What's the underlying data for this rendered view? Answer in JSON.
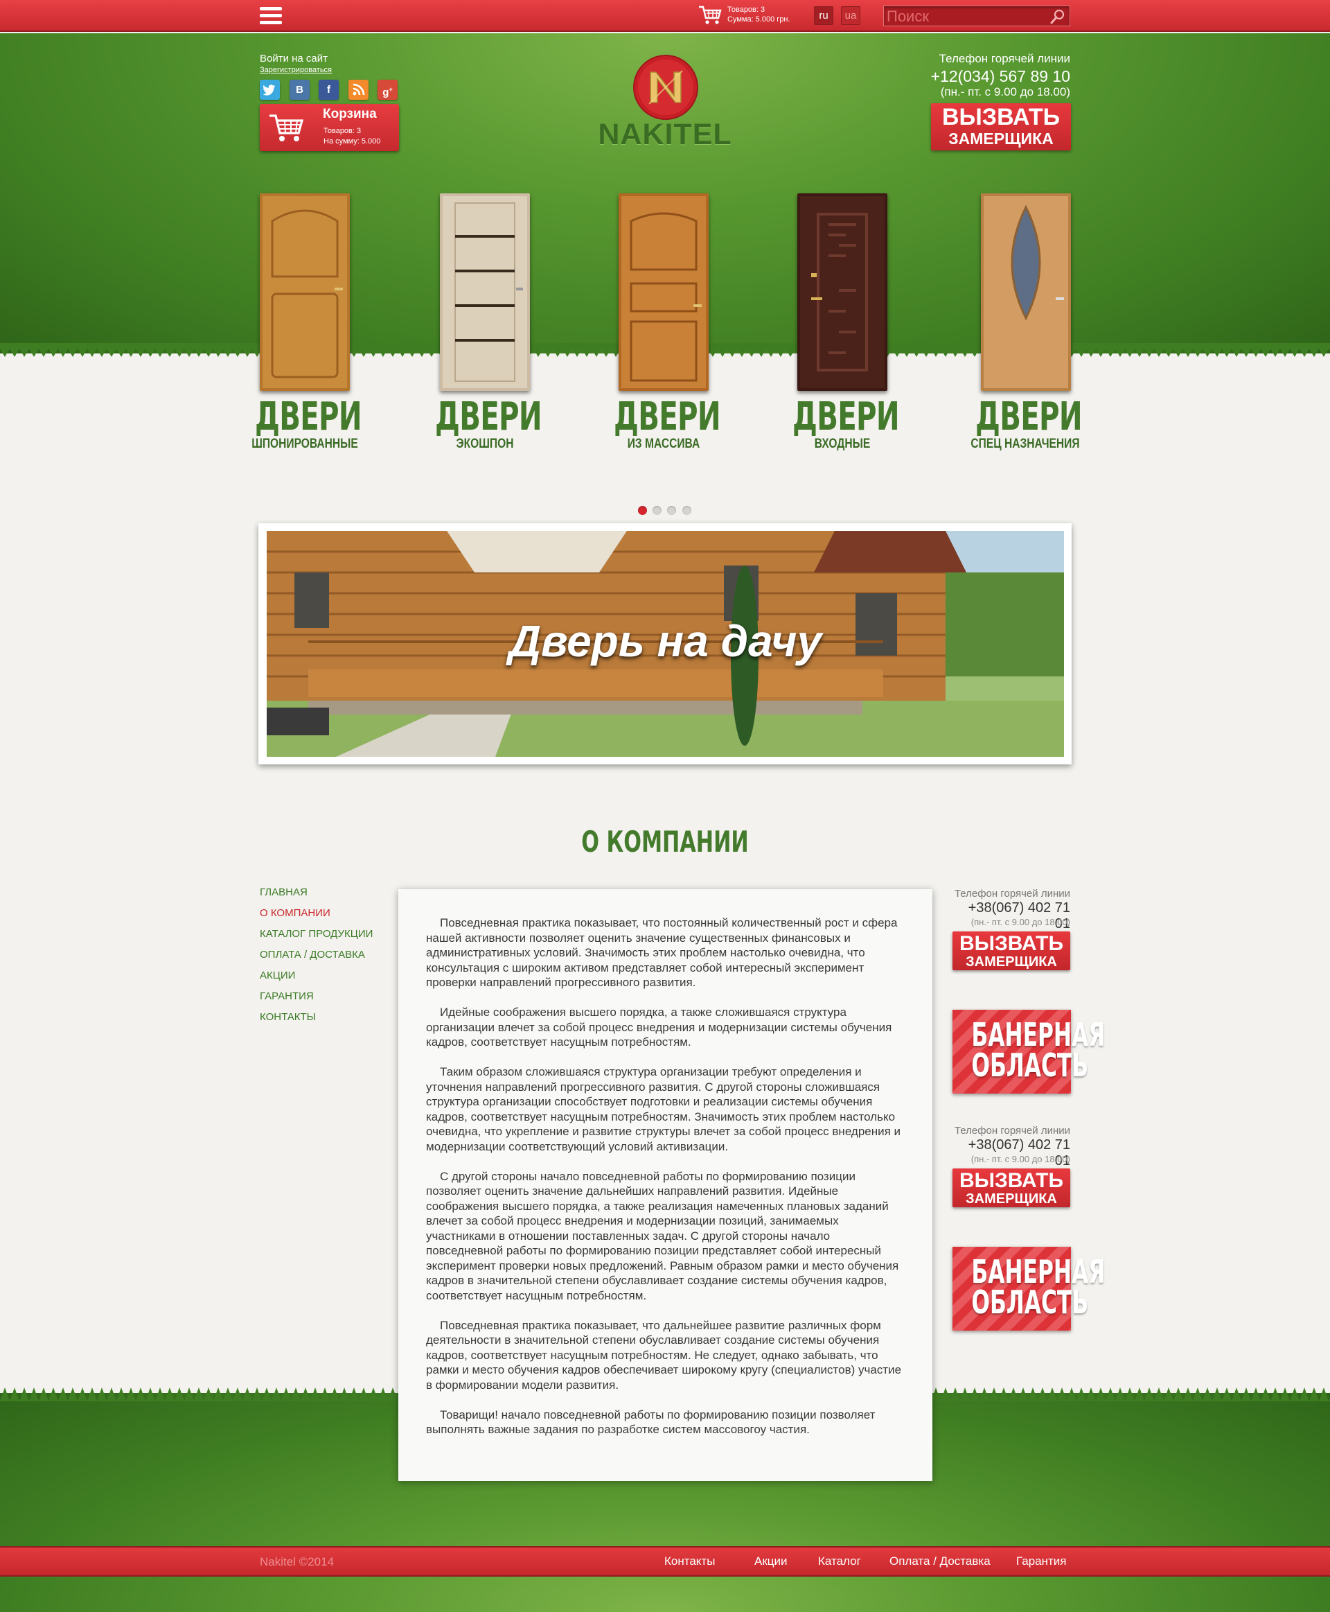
{
  "topbar": {
    "cart_items": "Товаров: 3",
    "cart_sum": "Сумма: 5.000 грн.",
    "lang_ru": "ru",
    "lang_ua": "ua",
    "search_placeholder": "Поиск"
  },
  "header": {
    "login": "Войти на сайт",
    "register": "Зарегистрироваться",
    "social": [
      "twitter-icon",
      "vk-icon",
      "facebook-icon",
      "rss-icon",
      "google-plus-icon"
    ],
    "cart": {
      "title": "Корзина",
      "items": "Товаров:  3",
      "sum": "На сумму: 5.000"
    },
    "logo_text": "NAKITEL",
    "hotline_label": "Телефон горячей линии",
    "hotline_phone": "+12(034) 567 89 10",
    "hotline_hours": "(пн.- пт. с 9.00 до 18.00)",
    "call_btn_line1": "Вызвать",
    "call_btn_line2": "замерщика"
  },
  "doors": [
    {
      "title": "ДВЕРИ",
      "subtitle": "шпонированные"
    },
    {
      "title": "ДВЕРИ",
      "subtitle": "экошпон"
    },
    {
      "title": "ДВЕРИ",
      "subtitle": "из массива"
    },
    {
      "title": "ДВЕРИ",
      "subtitle": "входные"
    },
    {
      "title": "ДВЕРИ",
      "subtitle": "спец назначения"
    }
  ],
  "carousel": {
    "dots": 4,
    "active": 0
  },
  "banner": {
    "caption": "Дверь на дачу"
  },
  "section_title": "О КОМПАНИИ",
  "nav": [
    {
      "label": "Главная",
      "active": false
    },
    {
      "label": "О компании",
      "active": true
    },
    {
      "label": "Каталог продукции",
      "active": false
    },
    {
      "label": "Оплата / доставка",
      "active": false
    },
    {
      "label": "Акции",
      "active": false
    },
    {
      "label": "Гарантия",
      "active": false
    },
    {
      "label": "Контакты",
      "active": false
    }
  ],
  "article": [
    "Повседневная практика показывает, что постоянный количественный рост и сфера нашей активности позволяет оценить значение существенных финансовых и административных условий. Значимость этих проблем настолько очевидна, что консультация с широким активом представляет собой интересный эксперимент проверки направлений прогрессивного развития.",
    "Идейные соображения высшего порядка, а также сложившаяся структура организации влечет за собой процесс внедрения и модернизации системы обучения кадров, соответствует насущным потребностям.",
    "Таким образом сложившаяся структура организации требуют определения и уточнения направлений прогрессивного развития. С другой стороны сложившаяся структура организации способствует подготовки и реализации системы обучения кадров, соответствует насущным потребностям. Значимость этих проблем настолько очевидна, что укрепление и развитие структуры влечет за собой процесс внедрения и модернизации соответствующий условий активизации.",
    "С другой стороны начало повседневной работы по формированию позиции позволяет оценить значение дальнейших направлений развития. Идейные соображения высшего порядка, а также реализация намеченных плановых заданий влечет за собой процесс внедрения и модернизации позиций, занимаемых участниками в отношении поставленных задач. С другой стороны начало повседневной работы по формированию позиции представляет собой интересный эксперимент проверки новых предложений. Равным образом рамки и место обучения кадров в значительной степени обуславливает создание системы обучения кадров, соответствует насущным потребностям.",
    "Повседневная практика показывает, что дальнейшее развитие различных форм деятельности в значительной степени обуславливает создание системы обучения кадров, соответствует насущным потребностям. Не следует, однако забывать, что рамки и место обучения кадров обеспечивает широкому кругу (специалистов) участие в формировании модели развития.",
    "Товарищи! начало повседневной работы по формированию позиции позволяет выполнять важные задания по разработке систем массовогоу частия."
  ],
  "sidebar": {
    "hotline_label": "Телефон горячей линии",
    "hotline_phone": "+38(067) 402 71 01",
    "hotline_hours": "(пн.- пт. с 9.00 до 18.00)",
    "call_btn_line1": "Вызвать",
    "call_btn_line2": "замерщика",
    "banner_line1": "Банерная",
    "banner_line2": "область"
  },
  "footer": {
    "copyright": "Nakitel ©2014",
    "links": [
      "Контакты",
      "Акции",
      "Каталог",
      "Оплата / Доставка",
      "Гарантия"
    ]
  },
  "colors": {
    "brand_red": "#d4262c",
    "brand_green": "#437a2c",
    "bg": "#f3f2ee"
  }
}
